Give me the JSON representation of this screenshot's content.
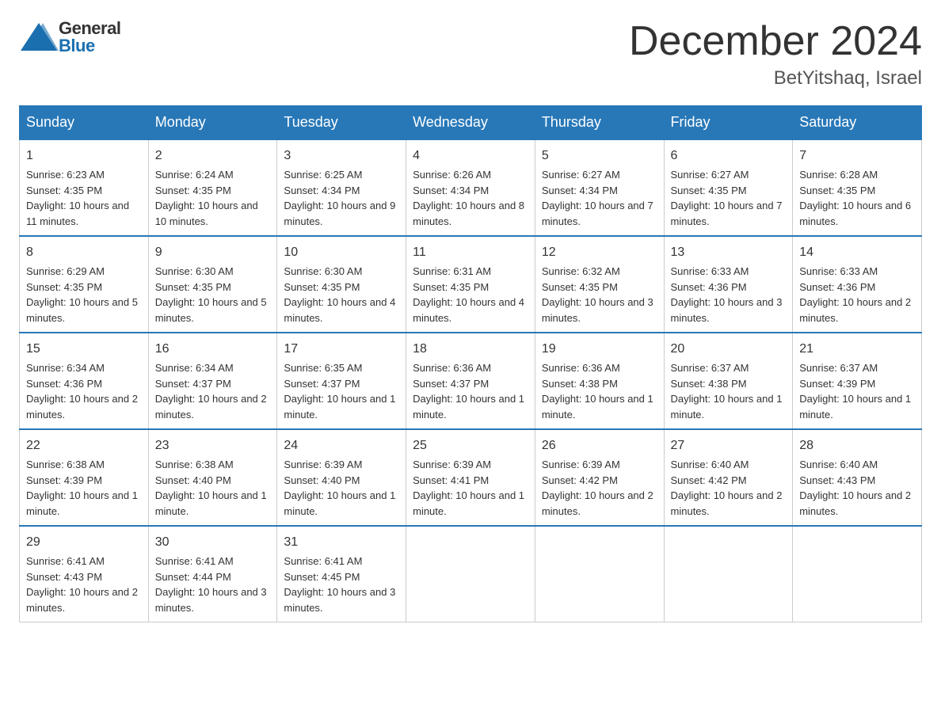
{
  "header": {
    "logo_general": "General",
    "logo_blue": "Blue",
    "month_title": "December 2024",
    "location": "BetYitshaq, Israel"
  },
  "days_of_week": [
    "Sunday",
    "Monday",
    "Tuesday",
    "Wednesday",
    "Thursday",
    "Friday",
    "Saturday"
  ],
  "weeks": [
    [
      {
        "day": "1",
        "sunrise": "6:23 AM",
        "sunset": "4:35 PM",
        "daylight": "10 hours and 11 minutes."
      },
      {
        "day": "2",
        "sunrise": "6:24 AM",
        "sunset": "4:35 PM",
        "daylight": "10 hours and 10 minutes."
      },
      {
        "day": "3",
        "sunrise": "6:25 AM",
        "sunset": "4:34 PM",
        "daylight": "10 hours and 9 minutes."
      },
      {
        "day": "4",
        "sunrise": "6:26 AM",
        "sunset": "4:34 PM",
        "daylight": "10 hours and 8 minutes."
      },
      {
        "day": "5",
        "sunrise": "6:27 AM",
        "sunset": "4:34 PM",
        "daylight": "10 hours and 7 minutes."
      },
      {
        "day": "6",
        "sunrise": "6:27 AM",
        "sunset": "4:35 PM",
        "daylight": "10 hours and 7 minutes."
      },
      {
        "day": "7",
        "sunrise": "6:28 AM",
        "sunset": "4:35 PM",
        "daylight": "10 hours and 6 minutes."
      }
    ],
    [
      {
        "day": "8",
        "sunrise": "6:29 AM",
        "sunset": "4:35 PM",
        "daylight": "10 hours and 5 minutes."
      },
      {
        "day": "9",
        "sunrise": "6:30 AM",
        "sunset": "4:35 PM",
        "daylight": "10 hours and 5 minutes."
      },
      {
        "day": "10",
        "sunrise": "6:30 AM",
        "sunset": "4:35 PM",
        "daylight": "10 hours and 4 minutes."
      },
      {
        "day": "11",
        "sunrise": "6:31 AM",
        "sunset": "4:35 PM",
        "daylight": "10 hours and 4 minutes."
      },
      {
        "day": "12",
        "sunrise": "6:32 AM",
        "sunset": "4:35 PM",
        "daylight": "10 hours and 3 minutes."
      },
      {
        "day": "13",
        "sunrise": "6:33 AM",
        "sunset": "4:36 PM",
        "daylight": "10 hours and 3 minutes."
      },
      {
        "day": "14",
        "sunrise": "6:33 AM",
        "sunset": "4:36 PM",
        "daylight": "10 hours and 2 minutes."
      }
    ],
    [
      {
        "day": "15",
        "sunrise": "6:34 AM",
        "sunset": "4:36 PM",
        "daylight": "10 hours and 2 minutes."
      },
      {
        "day": "16",
        "sunrise": "6:34 AM",
        "sunset": "4:37 PM",
        "daylight": "10 hours and 2 minutes."
      },
      {
        "day": "17",
        "sunrise": "6:35 AM",
        "sunset": "4:37 PM",
        "daylight": "10 hours and 1 minute."
      },
      {
        "day": "18",
        "sunrise": "6:36 AM",
        "sunset": "4:37 PM",
        "daylight": "10 hours and 1 minute."
      },
      {
        "day": "19",
        "sunrise": "6:36 AM",
        "sunset": "4:38 PM",
        "daylight": "10 hours and 1 minute."
      },
      {
        "day": "20",
        "sunrise": "6:37 AM",
        "sunset": "4:38 PM",
        "daylight": "10 hours and 1 minute."
      },
      {
        "day": "21",
        "sunrise": "6:37 AM",
        "sunset": "4:39 PM",
        "daylight": "10 hours and 1 minute."
      }
    ],
    [
      {
        "day": "22",
        "sunrise": "6:38 AM",
        "sunset": "4:39 PM",
        "daylight": "10 hours and 1 minute."
      },
      {
        "day": "23",
        "sunrise": "6:38 AM",
        "sunset": "4:40 PM",
        "daylight": "10 hours and 1 minute."
      },
      {
        "day": "24",
        "sunrise": "6:39 AM",
        "sunset": "4:40 PM",
        "daylight": "10 hours and 1 minute."
      },
      {
        "day": "25",
        "sunrise": "6:39 AM",
        "sunset": "4:41 PM",
        "daylight": "10 hours and 1 minute."
      },
      {
        "day": "26",
        "sunrise": "6:39 AM",
        "sunset": "4:42 PM",
        "daylight": "10 hours and 2 minutes."
      },
      {
        "day": "27",
        "sunrise": "6:40 AM",
        "sunset": "4:42 PM",
        "daylight": "10 hours and 2 minutes."
      },
      {
        "day": "28",
        "sunrise": "6:40 AM",
        "sunset": "4:43 PM",
        "daylight": "10 hours and 2 minutes."
      }
    ],
    [
      {
        "day": "29",
        "sunrise": "6:41 AM",
        "sunset": "4:43 PM",
        "daylight": "10 hours and 2 minutes."
      },
      {
        "day": "30",
        "sunrise": "6:41 AM",
        "sunset": "4:44 PM",
        "daylight": "10 hours and 3 minutes."
      },
      {
        "day": "31",
        "sunrise": "6:41 AM",
        "sunset": "4:45 PM",
        "daylight": "10 hours and 3 minutes."
      },
      null,
      null,
      null,
      null
    ]
  ],
  "labels": {
    "sunrise": "Sunrise:",
    "sunset": "Sunset:",
    "daylight": "Daylight:"
  }
}
